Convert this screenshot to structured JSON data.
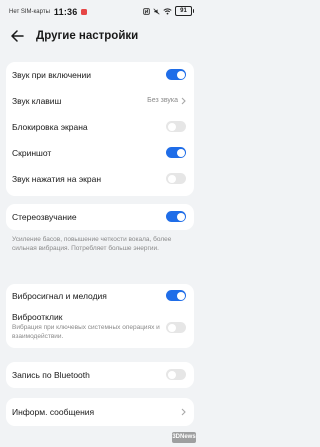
{
  "status_bar": {
    "carrier": "Нет SIM-карты",
    "time": "11:36",
    "battery": "91"
  },
  "header": {
    "title": "Другие настройки"
  },
  "section1": {
    "startup_sound": {
      "label": "Звук при включении",
      "on": true
    },
    "key_sound": {
      "label": "Звук клавиш",
      "value": "Без звука"
    },
    "screen_lock": {
      "label": "Блокировка экрана",
      "on": false
    },
    "screenshot": {
      "label": "Скриншот",
      "on": true
    },
    "touch_sound": {
      "label": "Звук нажатия на экран",
      "on": false
    }
  },
  "section2": {
    "stereo": {
      "label": "Стереозвучание",
      "on": true
    },
    "note": "Усиление басов, повышение четкости вокала, более сильная вибрация. Потребляет больше энергии."
  },
  "section3": {
    "vibro_ringtone": {
      "label": "Вибросигнал и мелодия",
      "on": true
    },
    "vibro_click": {
      "label": "Виброотклик",
      "description": "Вибрация при ключевых системных операциях и взаимодействии.",
      "on": false
    }
  },
  "section4": {
    "bluetooth_record": {
      "label": "Запись по Bluetooth",
      "on": false
    }
  },
  "section5": {
    "info_messages": {
      "label": "Информ. сообщения"
    }
  },
  "watermark": "3DNews",
  "colors": {
    "accent": "#1f6de8",
    "toggle_off": "#e6e6e6",
    "background": "#f1f3f5"
  }
}
